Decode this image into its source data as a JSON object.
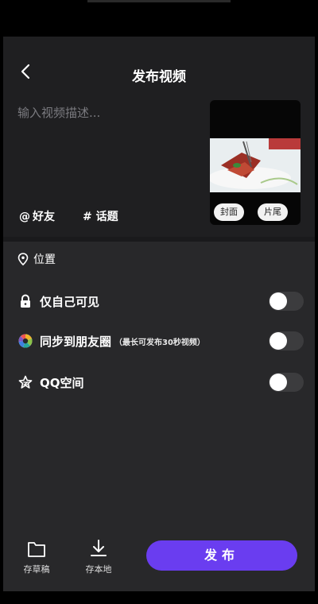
{
  "header": {
    "title": "发布视频"
  },
  "description": {
    "placeholder": "输入视频描述..."
  },
  "cover": {
    "cover_label": "封面",
    "ending_label": "片尾"
  },
  "tags": {
    "mention_label": "好友",
    "topic_label": "话题"
  },
  "location": {
    "label": "位置"
  },
  "options": [
    {
      "label": "仅自己可见",
      "note": "",
      "enabled": false
    },
    {
      "label": "同步到朋友圈",
      "note": "（最长可发布30秒视频）",
      "enabled": false
    },
    {
      "label": "QQ空间",
      "note": "",
      "enabled": false
    }
  ],
  "footer": {
    "draft_label": "存草稿",
    "local_label": "存本地",
    "publish_label": "发布"
  },
  "colors": {
    "accent": "#6a3df0",
    "background": "#1f1f21",
    "panel": "#28282a"
  }
}
